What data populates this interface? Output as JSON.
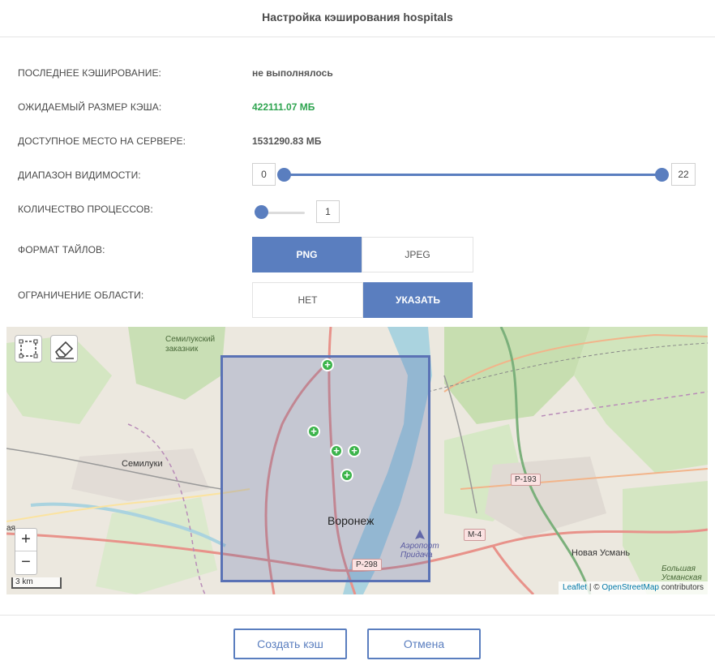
{
  "dialog": {
    "title": "Настройка кэширования hospitals"
  },
  "rows": {
    "last_cache": {
      "label": "ПОСЛЕДНЕЕ КЭШИРОВАНИЕ:",
      "value": "не выполнялось"
    },
    "expected_size": {
      "label": "ОЖИДАЕМЫЙ РАЗМЕР КЭША:",
      "value": "422111.07 МБ",
      "color": "#2ea44f"
    },
    "free_space": {
      "label": "ДОСТУПНОЕ МЕСТО НА СЕРВЕРЕ:",
      "value": "1531290.83 МБ"
    },
    "visibility": {
      "label": "ДИАПАЗОН ВИДИМОСТИ:",
      "min": "0",
      "max": "22"
    },
    "processes": {
      "label": "КОЛИЧЕСТВО ПРОЦЕССОВ:",
      "value": "1"
    },
    "tile_format": {
      "label": "ФОРМАТ ТАЙЛОВ:",
      "options": [
        "PNG",
        "JPEG"
      ],
      "selected": "PNG"
    },
    "area_limit": {
      "label": "ОГРАНИЧЕНИЕ ОБЛАСТИ:",
      "options": [
        "НЕТ",
        "УКАЗАТЬ"
      ],
      "selected": "УКАЗАТЬ"
    }
  },
  "map": {
    "labels": {
      "reserve": "Семилукский заказник",
      "semiluki": "Семилуки",
      "voronezh": "Воронеж",
      "airport": "Аэропорт Придача",
      "new_usman": "Новая Усмань",
      "bolshaya_usmanka": "Большая Усманская",
      "left_edge": "ая"
    },
    "roads": [
      "Р-193",
      "М-4",
      "Р-298"
    ],
    "zoom_in": "+",
    "zoom_out": "−",
    "scale": "3 km",
    "attribution": {
      "leaflet": "Leaflet",
      "sep": " | © ",
      "osm": "OpenStreetMap",
      "suffix": " contributors"
    },
    "accent": "#5a7ebf"
  },
  "buttons": {
    "create": "Создать кэш",
    "cancel": "Отмена"
  }
}
